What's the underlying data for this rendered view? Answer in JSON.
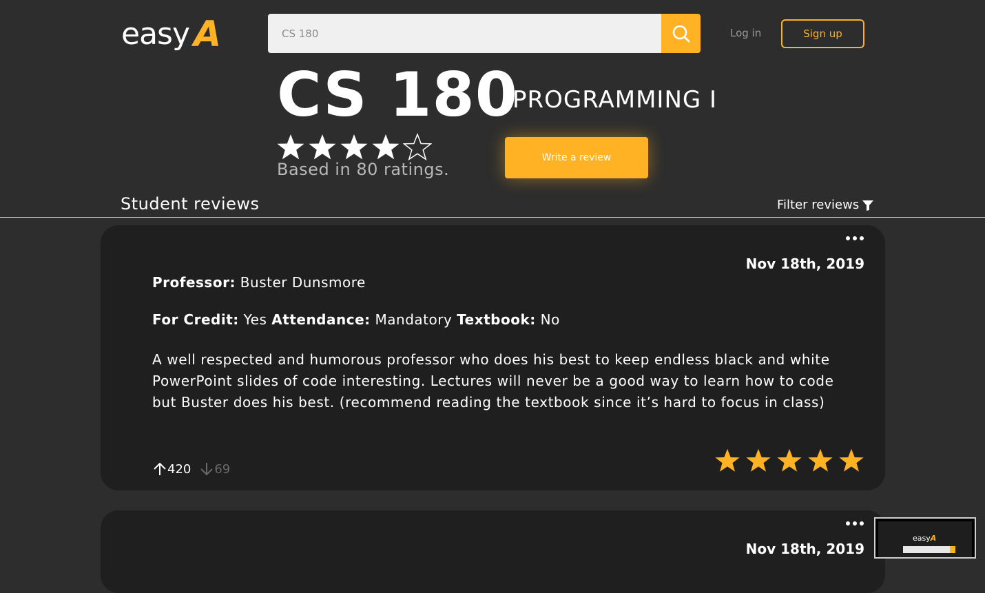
{
  "logo": {
    "easy": "easy",
    "a": "A"
  },
  "search": {
    "value": "CS 180"
  },
  "header": {
    "login": "Log in",
    "signup": "Sign up"
  },
  "course": {
    "code": "CS 180",
    "name": "PROGRAMMING I",
    "rating": 4,
    "rating_max": 5,
    "based_on": "Based in 80 ratings."
  },
  "actions": {
    "write_review": "Write a review"
  },
  "reviews_section": {
    "title": "Student reviews",
    "filter": "Filter reviews"
  },
  "reviews": [
    {
      "date": "Nov 18th, 2019",
      "professor_label": "Professor:",
      "professor": "Buster Dunsmore",
      "credit_label": "For Credit:",
      "credit": "Yes",
      "attendance_label": "Attendance:",
      "attendance": "Mandatory",
      "textbook_label": "Textbook:",
      "textbook": "No",
      "text": "A well respected and humorous professor who does his best to keep endless black and white PowerPoint slides of code interesting. Lectures will never be a good way to learn how to code but Buster does his best. (recommend reading the textbook since it’s hard to focus in class)",
      "upvotes": "420",
      "downvotes": "69",
      "stars": 5
    },
    {
      "date": "Nov 18th, 2019"
    }
  ],
  "thumbnail": {
    "easy": "easy",
    "a": "A"
  },
  "colors": {
    "accent": "#ffb324",
    "background": "#2d2d2d",
    "card": "#1f1f1f"
  },
  "icons": [
    "search-icon",
    "star-icon",
    "filter-icon",
    "more-icon",
    "arrow-up-icon",
    "arrow-down-icon"
  ]
}
